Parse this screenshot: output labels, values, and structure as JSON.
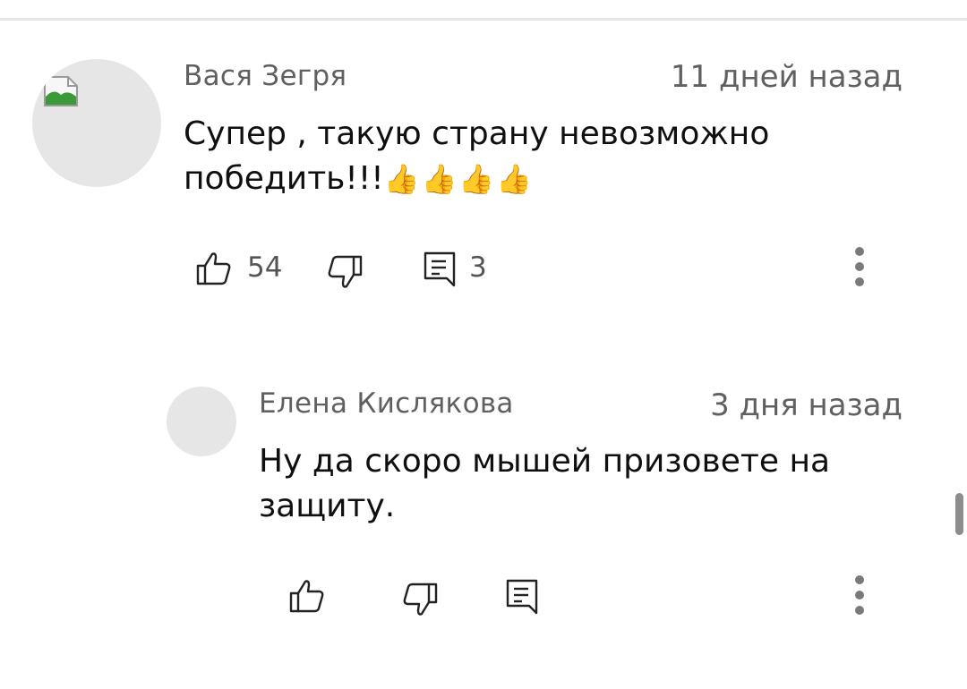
{
  "comments": [
    {
      "author": "Вася Зегря",
      "time": "11 дней назад",
      "text_line1": "Супер , такую страну невозможно",
      "text_line2": "победить!!!",
      "emoji": "👍👍👍👍",
      "likes": "54",
      "replies": "3",
      "avatar_icon": "broken-image-icon"
    },
    {
      "author": "Елена Кислякова",
      "time": "3 дня назад",
      "text_line1": "Ну да скоро мышей призовете на",
      "text_line2": "защиту.",
      "likes": "",
      "replies": ""
    }
  ],
  "icons": {
    "like": "thumbs-up-icon",
    "dislike": "thumbs-down-icon",
    "reply": "comment-icon",
    "more": "more-vertical-icon"
  },
  "colors": {
    "text_primary": "#0f0f0f",
    "text_secondary": "#606060",
    "avatar_placeholder": "#e6e6e6"
  }
}
